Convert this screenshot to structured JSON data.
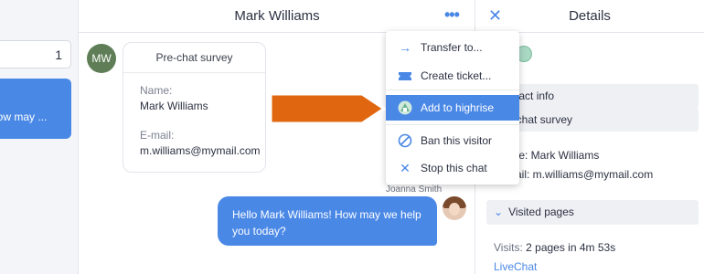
{
  "left_panel": {
    "count": "1",
    "preview": "How may ..."
  },
  "chat": {
    "title": "Mark Williams",
    "more_icon": "ellipsis-horizontal-icon",
    "avatar_initials": "MW",
    "survey": {
      "title": "Pre-chat survey",
      "name_label": "Name:",
      "name_value": "Mark Williams",
      "email_label": "E-mail:",
      "email_value": "m.williams@mymail.com"
    },
    "agent_name": "Joanna Smith",
    "agent_message": "Hello Mark Williams! How may we help you today?"
  },
  "details": {
    "title": "Details",
    "contact_info": "Contact info",
    "prechat_survey": "Pre-chat survey",
    "name_line": "Name: Mark Williams",
    "email_line": "E-mail: m.williams@mymail.com",
    "visited_pages": "Visited pages",
    "visits_label": "Visits:",
    "visits_value": "2 pages in 4m 53s",
    "site_link": "LiveChat"
  },
  "menu": {
    "items": [
      {
        "label": "Transfer to...",
        "icon": "arrow-right-icon"
      },
      {
        "label": "Create ticket...",
        "icon": "ticket-icon"
      },
      {
        "label": "Add to highrise",
        "icon": "highrise-icon",
        "highlighted": true
      },
      {
        "label": "Ban this visitor",
        "icon": "ban-icon"
      },
      {
        "label": "Stop this chat",
        "icon": "close-icon"
      }
    ]
  },
  "colors": {
    "accent": "#4a88e6",
    "annotation_arrow": "#e0670f",
    "avatar_bg": "#5f7e57"
  }
}
